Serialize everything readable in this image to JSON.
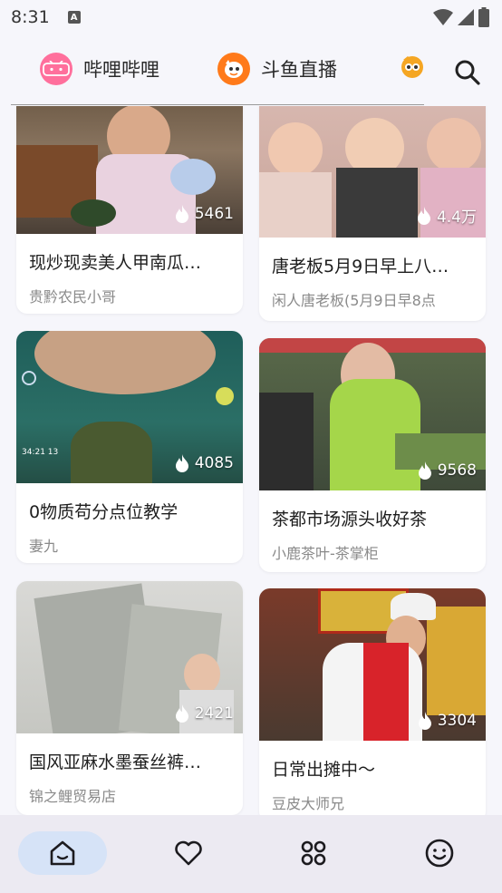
{
  "status_bar": {
    "time": "8:31",
    "notification_icon": "A"
  },
  "top_tabs": [
    {
      "label": "哔哩哔哩",
      "icon": "bilibili-icon",
      "color": "#ff6f9c"
    },
    {
      "label": "斗鱼直播",
      "icon": "douyu-icon",
      "color": "#ff7a1a"
    },
    {
      "label": "",
      "icon": "huya-icon",
      "color": "#f5a623"
    }
  ],
  "search": {
    "icon": "search-icon"
  },
  "feed": {
    "cards": [
      {
        "title": "现炒现卖美人甲南瓜…",
        "author": "贵黔农民小哥",
        "heat": "5461"
      },
      {
        "title": "唐老板5月9日早上八…",
        "author": "闲人唐老板(5月9日早8点",
        "heat": "4.4万"
      },
      {
        "title": "0物质苟分点位教学",
        "author": "妻九",
        "heat": "4085"
      },
      {
        "title": "茶都市场源头收好茶",
        "author": "小鹿茶叶-茶掌柜",
        "heat": "9568"
      },
      {
        "title": "国风亚麻水墨蚕丝裤…",
        "author": "锦之鲤贸易店",
        "heat": "2421"
      },
      {
        "title": "日常出摊中～",
        "author": "豆皮大师兄",
        "heat": "3304"
      }
    ]
  },
  "bottom_nav": [
    {
      "icon": "home-icon",
      "active": true
    },
    {
      "icon": "heart-icon",
      "active": false
    },
    {
      "icon": "apps-icon",
      "active": false
    },
    {
      "icon": "smile-icon",
      "active": false
    }
  ]
}
